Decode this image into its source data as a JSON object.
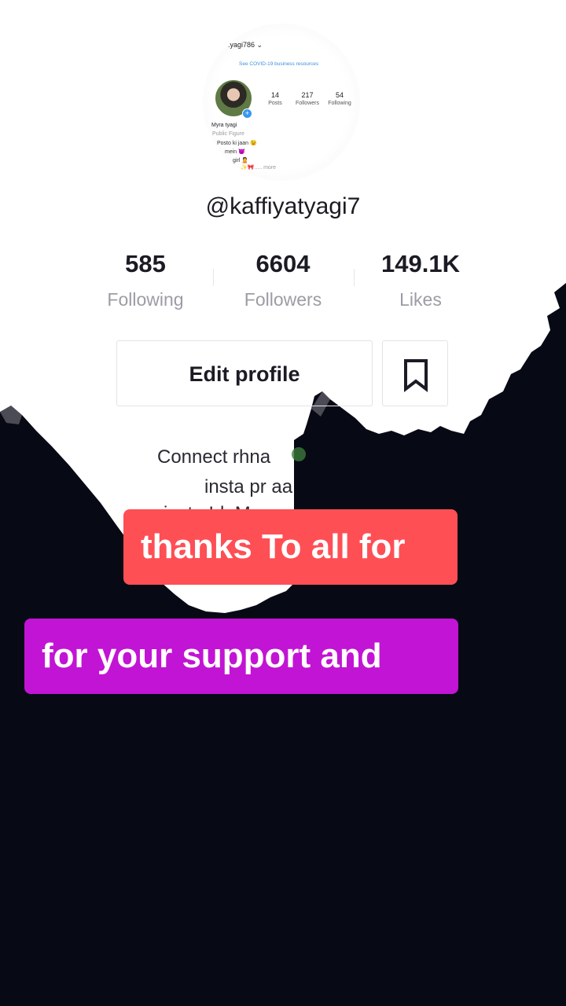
{
  "inset": {
    "username": ".yagi786 ⌄",
    "covid_link": "See COVID-19 business resources",
    "stats": [
      {
        "value": "14",
        "label": "Posts"
      },
      {
        "value": "217",
        "label": "Followers"
      },
      {
        "value": "54",
        "label": "Following"
      }
    ],
    "bio": {
      "name": "Myra tyagi",
      "category": "Public Figure",
      "line1": "Posto ki jaan 😉",
      "line2": "mein 😈",
      "line3": "girl 🙎",
      "line4": "✨🎀..... more"
    }
  },
  "profile": {
    "handle": "@kaffiyatyagi7",
    "stats": [
      {
        "value": "585",
        "label": "Following"
      },
      {
        "value": "6604",
        "label": "Followers"
      },
      {
        "value": "149.1K",
        "label": "Likes"
      }
    ],
    "edit_button": "Edit profile",
    "bio_lines": [
      "Connect rhna",
      "insta pr aa",
      "insta Id: M"
    ]
  },
  "captions": {
    "line1": "thanks To all for",
    "line2": "for your support and"
  },
  "colors": {
    "caption1_bg": "#fe4f55",
    "caption2_bg": "#c214d4",
    "dark_bg": "#070914"
  }
}
